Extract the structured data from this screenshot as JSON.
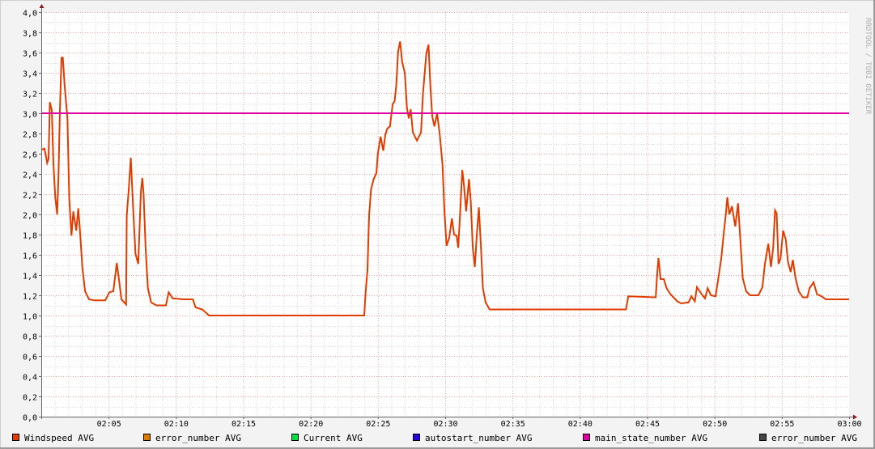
{
  "chart_data": {
    "type": "line",
    "title": "",
    "xlabel": "",
    "ylabel": "",
    "xlim_minutes": [
      0,
      60
    ],
    "ylim": [
      0,
      4.0
    ],
    "grid": true,
    "x_tick_labels": [
      "02:05",
      "02:10",
      "02:15",
      "02:20",
      "02:25",
      "02:30",
      "02:35",
      "02:40",
      "02:45",
      "02:50",
      "02:55",
      "03:00"
    ],
    "y_tick_labels": [
      "0,0",
      "0,2",
      "0,4",
      "0,6",
      "0,8",
      "1,0",
      "1,2",
      "1,4",
      "1,6",
      "1,8",
      "2,0",
      "2,2",
      "2,4",
      "2,6",
      "2,8",
      "3,0",
      "3,2",
      "3,4",
      "3,6",
      "3,8",
      "4,0"
    ],
    "watermark": "RRDTOOL / TOBI OETIKER",
    "x_unit": "minutes after 02:00",
    "legend_placement": "bottom",
    "legend": [
      {
        "name": "Windspeed AVG",
        "color": "#e03c00"
      },
      {
        "name": "error_number AVG",
        "color": "#e07800"
      },
      {
        "name": "Current AVG",
        "color": "#00e040"
      },
      {
        "name": "autostart_number AVG",
        "color": "#2800e0"
      },
      {
        "name": "main_state_number AVG",
        "color": "#e000a0"
      },
      {
        "name": "error_number AVG",
        "color": "#444444"
      }
    ],
    "series": [
      {
        "name": "Windspeed AVG",
        "color": "#e03c00",
        "points": [
          [
            0,
            2.64
          ],
          [
            0.24,
            2.65
          ],
          [
            0.44,
            2.51
          ],
          [
            0.54,
            2.55
          ],
          [
            0.64,
            3.11
          ],
          [
            0.78,
            3.03
          ],
          [
            0.9,
            2.5
          ],
          [
            1.04,
            2.17
          ],
          [
            1.18,
            2.0
          ],
          [
            1.28,
            2.39
          ],
          [
            1.38,
            3.03
          ],
          [
            1.5,
            3.55
          ],
          [
            1.6,
            3.55
          ],
          [
            1.74,
            3.27
          ],
          [
            1.94,
            2.95
          ],
          [
            2.08,
            2.15
          ],
          [
            2.24,
            1.79
          ],
          [
            2.38,
            2.03
          ],
          [
            2.6,
            1.84
          ],
          [
            2.75,
            2.06
          ],
          [
            2.9,
            1.79
          ],
          [
            3.05,
            1.48
          ],
          [
            3.25,
            1.24
          ],
          [
            3.55,
            1.16
          ],
          [
            3.95,
            1.15
          ],
          [
            4.75,
            1.15
          ],
          [
            5.05,
            1.23
          ],
          [
            5.35,
            1.24
          ],
          [
            5.61,
            1.52
          ],
          [
            5.75,
            1.38
          ],
          [
            5.95,
            1.16
          ],
          [
            6.3,
            1.11
          ],
          [
            6.35,
            1.99
          ],
          [
            6.5,
            2.25
          ],
          [
            6.65,
            2.56
          ],
          [
            6.85,
            1.99
          ],
          [
            7.0,
            1.61
          ],
          [
            7.2,
            1.51
          ],
          [
            7.4,
            2.23
          ],
          [
            7.5,
            2.36
          ],
          [
            7.6,
            2.2
          ],
          [
            7.75,
            1.67
          ],
          [
            7.92,
            1.27
          ],
          [
            8.16,
            1.13
          ],
          [
            8.56,
            1.1
          ],
          [
            9.26,
            1.1
          ],
          [
            9.46,
            1.23
          ],
          [
            9.76,
            1.17
          ],
          [
            10.56,
            1.16
          ],
          [
            11.26,
            1.16
          ],
          [
            11.46,
            1.08
          ],
          [
            11.96,
            1.06
          ],
          [
            12.46,
            1.0
          ],
          [
            23.99,
            1.0
          ],
          [
            24.09,
            1.23
          ],
          [
            24.23,
            1.45
          ],
          [
            24.35,
            1.99
          ],
          [
            24.49,
            2.25
          ],
          [
            24.69,
            2.35
          ],
          [
            24.89,
            2.41
          ],
          [
            25.0,
            2.6
          ],
          [
            25.2,
            2.77
          ],
          [
            25.4,
            2.63
          ],
          [
            25.56,
            2.79
          ],
          [
            25.7,
            2.85
          ],
          [
            25.9,
            2.87
          ],
          [
            26.1,
            3.09
          ],
          [
            26.24,
            3.12
          ],
          [
            26.36,
            3.27
          ],
          [
            26.5,
            3.61
          ],
          [
            26.65,
            3.71
          ],
          [
            26.8,
            3.51
          ],
          [
            27.0,
            3.4
          ],
          [
            27.16,
            3.05
          ],
          [
            27.3,
            2.95
          ],
          [
            27.44,
            3.04
          ],
          [
            27.6,
            2.81
          ],
          [
            27.9,
            2.73
          ],
          [
            28.2,
            2.81
          ],
          [
            28.36,
            3.21
          ],
          [
            28.6,
            3.59
          ],
          [
            28.76,
            3.68
          ],
          [
            28.9,
            3.27
          ],
          [
            29.04,
            2.97
          ],
          [
            29.2,
            2.87
          ],
          [
            29.4,
            3.0
          ],
          [
            29.6,
            2.79
          ],
          [
            29.8,
            2.49
          ],
          [
            29.94,
            2.04
          ],
          [
            30.1,
            1.69
          ],
          [
            30.3,
            1.77
          ],
          [
            30.5,
            1.96
          ],
          [
            30.66,
            1.8
          ],
          [
            30.85,
            1.79
          ],
          [
            30.97,
            1.67
          ],
          [
            31.1,
            1.99
          ],
          [
            31.27,
            2.44
          ],
          [
            31.4,
            2.28
          ],
          [
            31.56,
            2.03
          ],
          [
            31.77,
            2.35
          ],
          [
            31.9,
            2.13
          ],
          [
            32.05,
            1.67
          ],
          [
            32.2,
            1.48
          ],
          [
            32.35,
            1.8
          ],
          [
            32.5,
            2.07
          ],
          [
            32.65,
            1.69
          ],
          [
            32.8,
            1.27
          ],
          [
            33.0,
            1.13
          ],
          [
            33.3,
            1.06
          ],
          [
            43.43,
            1.06
          ],
          [
            43.6,
            1.19
          ],
          [
            45.64,
            1.18
          ],
          [
            45.74,
            1.4
          ],
          [
            45.84,
            1.57
          ],
          [
            46.0,
            1.36
          ],
          [
            46.24,
            1.36
          ],
          [
            46.44,
            1.27
          ],
          [
            46.74,
            1.21
          ],
          [
            47.24,
            1.14
          ],
          [
            47.54,
            1.12
          ],
          [
            48.08,
            1.13
          ],
          [
            48.28,
            1.19
          ],
          [
            48.54,
            1.14
          ],
          [
            48.7,
            1.28
          ],
          [
            49.05,
            1.21
          ],
          [
            49.3,
            1.17
          ],
          [
            49.5,
            1.27
          ],
          [
            49.74,
            1.2
          ],
          [
            50.08,
            1.19
          ],
          [
            50.28,
            1.36
          ],
          [
            50.5,
            1.56
          ],
          [
            50.68,
            1.8
          ],
          [
            50.85,
            2.01
          ],
          [
            50.95,
            2.17
          ],
          [
            51.1,
            2.0
          ],
          [
            51.3,
            2.08
          ],
          [
            51.55,
            1.88
          ],
          [
            51.75,
            2.11
          ],
          [
            51.95,
            1.69
          ],
          [
            52.1,
            1.37
          ],
          [
            52.35,
            1.24
          ],
          [
            52.65,
            1.2
          ],
          [
            53.26,
            1.2
          ],
          [
            53.56,
            1.28
          ],
          [
            53.75,
            1.51
          ],
          [
            54.0,
            1.71
          ],
          [
            54.2,
            1.48
          ],
          [
            54.36,
            1.67
          ],
          [
            54.5,
            2.04
          ],
          [
            54.62,
            2.01
          ],
          [
            54.76,
            1.51
          ],
          [
            54.9,
            1.56
          ],
          [
            55.1,
            1.84
          ],
          [
            55.3,
            1.75
          ],
          [
            55.46,
            1.53
          ],
          [
            55.66,
            1.43
          ],
          [
            55.82,
            1.55
          ],
          [
            56.02,
            1.37
          ],
          [
            56.26,
            1.24
          ],
          [
            56.56,
            1.18
          ],
          [
            56.9,
            1.18
          ],
          [
            57.06,
            1.27
          ],
          [
            57.36,
            1.33
          ],
          [
            57.62,
            1.21
          ],
          [
            57.97,
            1.19
          ],
          [
            58.27,
            1.16
          ],
          [
            60,
            1.16
          ]
        ]
      },
      {
        "name": "main_state_number AVG",
        "color": "#e000a0",
        "points": [
          [
            0,
            3.0
          ],
          [
            60,
            3.0
          ]
        ]
      }
    ]
  }
}
